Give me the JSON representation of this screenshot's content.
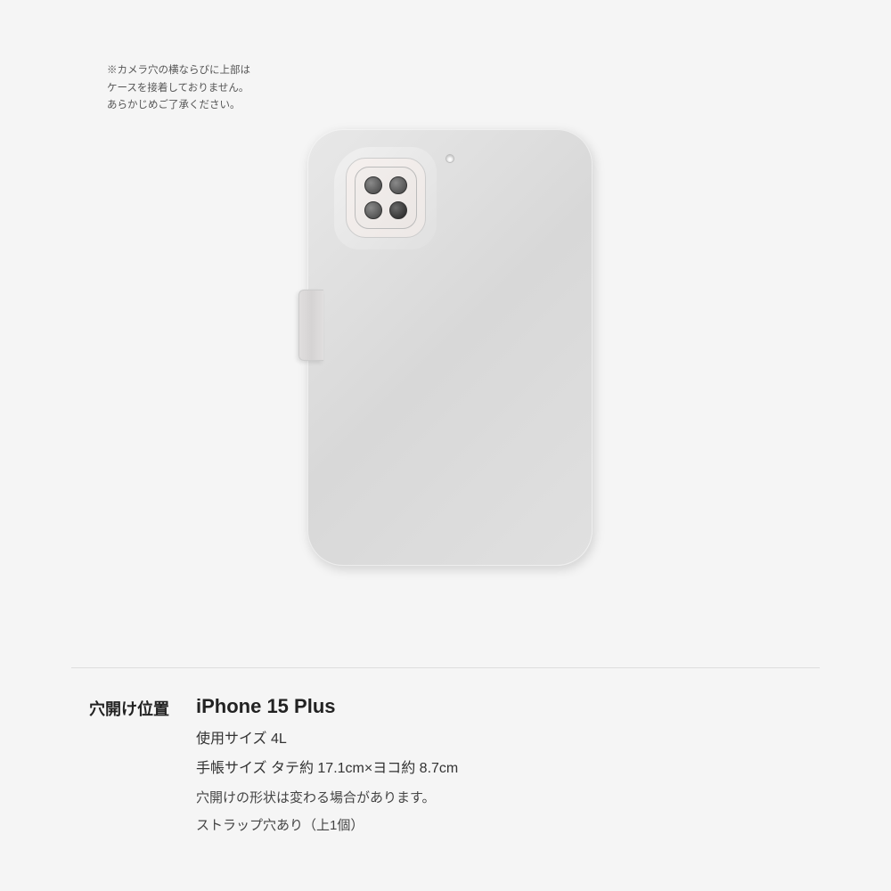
{
  "page": {
    "background_color": "#f5f5f5"
  },
  "warning": {
    "text": "※カメラ穴の横ならびに上部は\nケースを接着しておりません。\nあらかじめご了承ください。"
  },
  "phone_case": {
    "strap_hole_label": "strap hole",
    "color": "#e0e0e0"
  },
  "info_section": {
    "label": "穴開け位置",
    "device_name": "iPhone 15 Plus",
    "size_label": "使用サイズ 4L",
    "dimensions": "手帳サイズ タテ約 17.1cm×ヨコ約 8.7cm",
    "shape_note": "穴開けの形状は変わる場合があります。",
    "strap_note": "ストラップ穴あり（上1個）"
  }
}
